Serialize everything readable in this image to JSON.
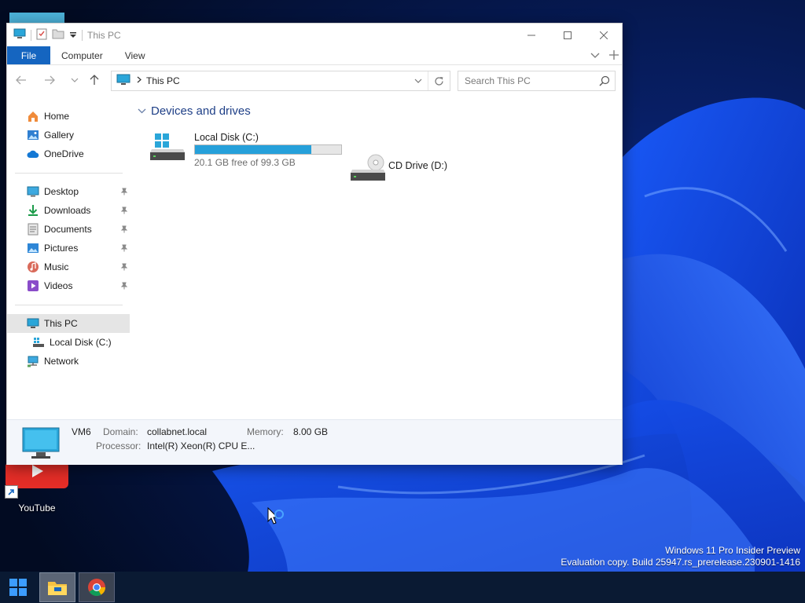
{
  "desktop": {
    "icons": [
      {
        "label": "YouTube"
      }
    ],
    "watermark": {
      "line1": "Windows 11 Pro Insider Preview",
      "line2": "Evaluation copy. Build 25947.rs_prerelease.230901-1416"
    }
  },
  "explorer": {
    "title": "This PC",
    "ribbon": {
      "tabs": [
        "File",
        "Computer",
        "View"
      ]
    },
    "address": {
      "crumb": "This PC"
    },
    "search": {
      "placeholder": "Search This PC"
    },
    "nav": {
      "quick": [
        {
          "label": "Home",
          "icon": "home-icon"
        },
        {
          "label": "Gallery",
          "icon": "gallery-icon"
        },
        {
          "label": "OneDrive",
          "icon": "onedrive-icon"
        }
      ],
      "pinned": [
        {
          "label": "Desktop",
          "icon": "desktop-folder-icon"
        },
        {
          "label": "Downloads",
          "icon": "downloads-icon"
        },
        {
          "label": "Documents",
          "icon": "documents-icon"
        },
        {
          "label": "Pictures",
          "icon": "pictures-icon"
        },
        {
          "label": "Music",
          "icon": "music-icon"
        },
        {
          "label": "Videos",
          "icon": "videos-icon"
        }
      ],
      "tree": [
        {
          "label": "This PC",
          "icon": "this-pc-icon",
          "selected": true
        },
        {
          "label": "Local Disk (C:)",
          "icon": "local-disk-icon"
        },
        {
          "label": "Network",
          "icon": "network-icon"
        }
      ]
    },
    "content": {
      "group": "Devices and drives",
      "drives": [
        {
          "name": "Local Disk (C:)",
          "free_text": "20.1 GB free of 99.3 GB",
          "used_fraction": 0.798
        },
        {
          "name": "CD Drive (D:)"
        }
      ]
    },
    "details": {
      "name": "VM6",
      "domain_label": "Domain:",
      "domain_value": "collabnet.local",
      "memory_label": "Memory:",
      "memory_value": "8.00 GB",
      "processor_label": "Processor:",
      "processor_value": "Intel(R) Xeon(R) CPU E..."
    }
  },
  "colors": {
    "accent": "#1565c0",
    "drive_bar": "#26a0da",
    "header_text": "#1e3f87"
  }
}
